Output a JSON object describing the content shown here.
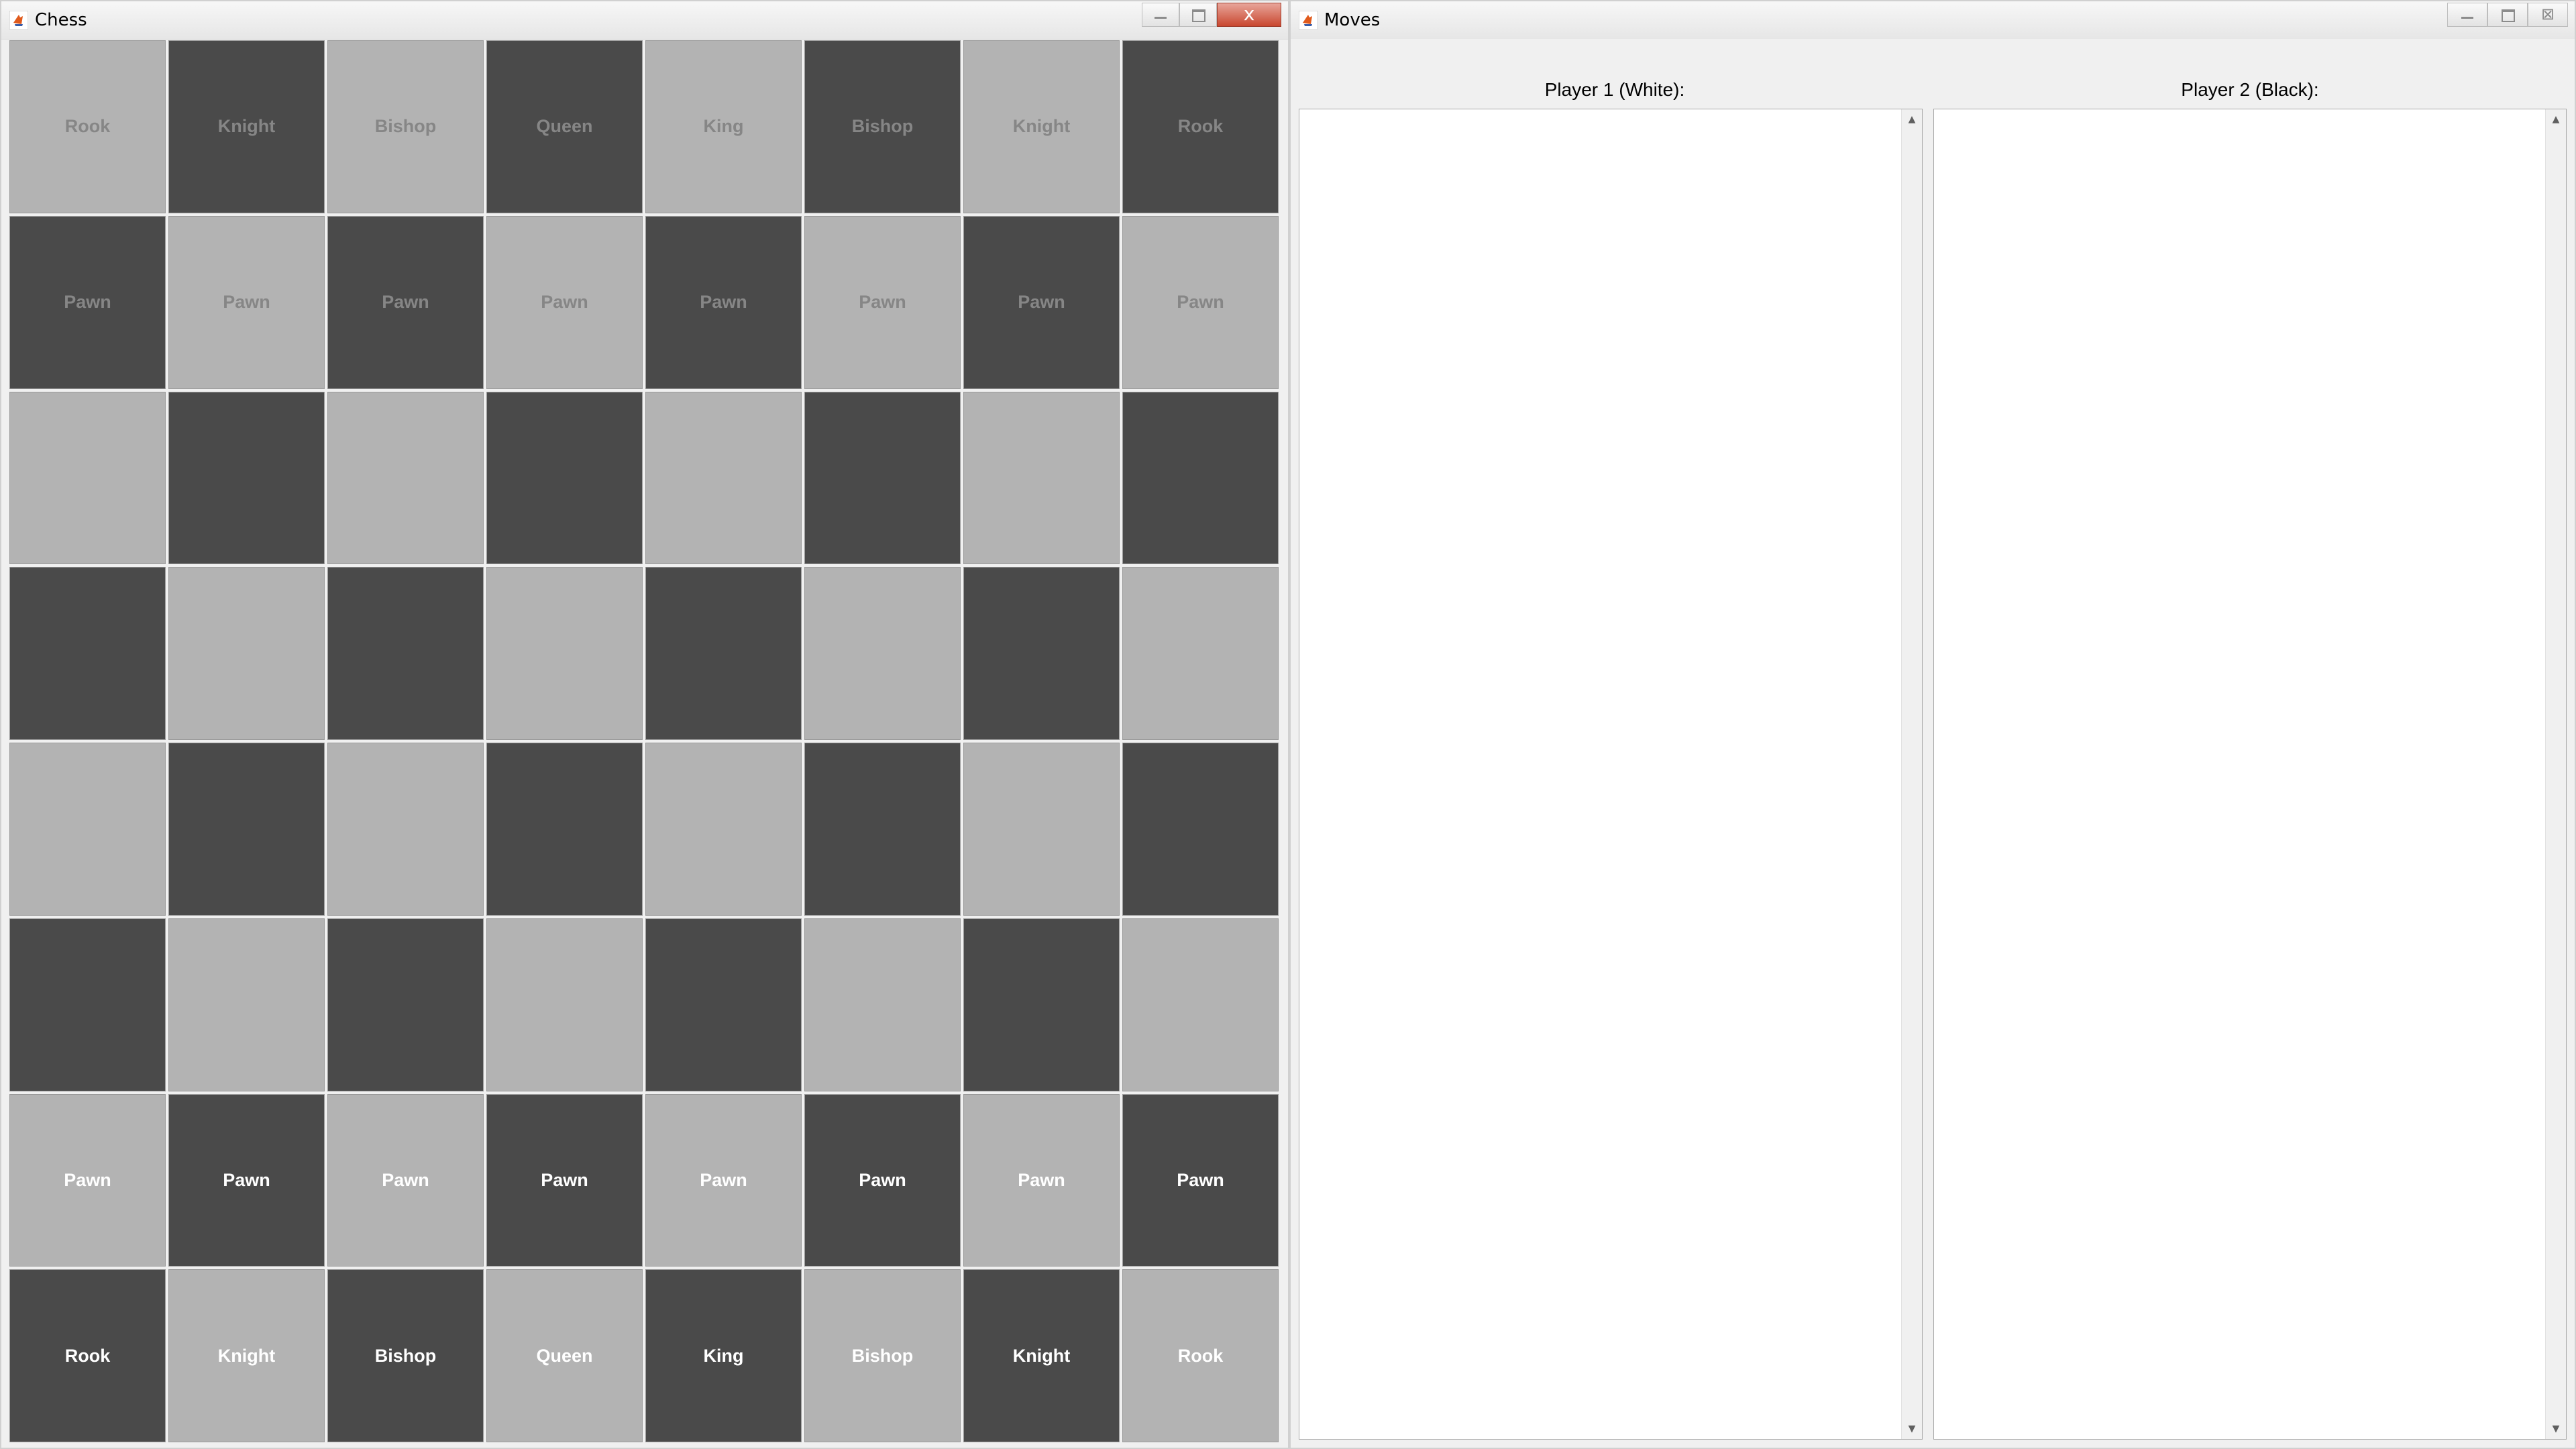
{
  "chess_window": {
    "title": "Chess",
    "close_glyph": "x",
    "icon": "java-cup-icon"
  },
  "moves_window": {
    "title": "Moves",
    "close_glyph": "⊠",
    "icon": "java-cup-icon",
    "player1_label": "Player 1 (White):",
    "player2_label": "Player 2 (Black):",
    "player1_moves": [],
    "player2_moves": []
  },
  "colors": {
    "light_square": "#b3b3b3",
    "dark_square": "#4a4a4a",
    "black_piece_text": "#868686",
    "white_piece_text": "#ffffff",
    "close_button": "#c9472f"
  },
  "board": {
    "ranks": [
      {
        "owner": "black",
        "pieces": [
          "Rook",
          "Knight",
          "Bishop",
          "Queen",
          "King",
          "Bishop",
          "Knight",
          "Rook"
        ]
      },
      {
        "owner": "black",
        "pieces": [
          "Pawn",
          "Pawn",
          "Pawn",
          "Pawn",
          "Pawn",
          "Pawn",
          "Pawn",
          "Pawn"
        ]
      },
      {
        "owner": "",
        "pieces": [
          "",
          "",
          "",
          "",
          "",
          "",
          "",
          ""
        ]
      },
      {
        "owner": "",
        "pieces": [
          "",
          "",
          "",
          "",
          "",
          "",
          "",
          ""
        ]
      },
      {
        "owner": "",
        "pieces": [
          "",
          "",
          "",
          "",
          "",
          "",
          "",
          ""
        ]
      },
      {
        "owner": "",
        "pieces": [
          "",
          "",
          "",
          "",
          "",
          "",
          "",
          ""
        ]
      },
      {
        "owner": "white",
        "pieces": [
          "Pawn",
          "Pawn",
          "Pawn",
          "Pawn",
          "Pawn",
          "Pawn",
          "Pawn",
          "Pawn"
        ]
      },
      {
        "owner": "white",
        "pieces": [
          "Rook",
          "Knight",
          "Bishop",
          "Queen",
          "King",
          "Bishop",
          "Knight",
          "Rook"
        ]
      }
    ]
  }
}
